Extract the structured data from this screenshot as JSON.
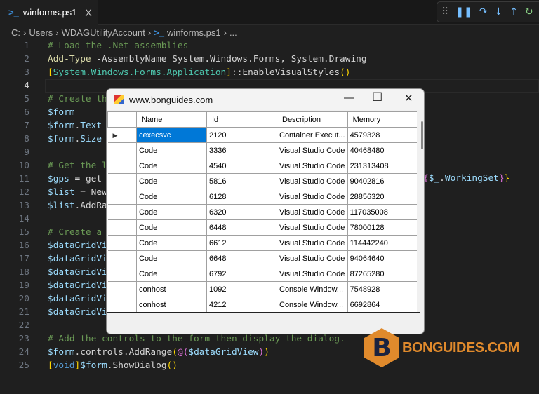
{
  "tab": {
    "title": "winforms.ps1",
    "close": "X",
    "icon": "powershell-icon"
  },
  "debug_toolbar": [
    "drag-icon",
    "pause-icon",
    "step-over-icon",
    "step-into-icon",
    "step-out-icon",
    "restart-icon"
  ],
  "breadcrumb": [
    "C:",
    "Users",
    "WDAGUtilityAccount",
    "winforms.ps1",
    "..."
  ],
  "code": [
    {
      "n": "1",
      "parts": [
        [
          "c",
          "# Load the .Net assemblies"
        ]
      ]
    },
    {
      "n": "2",
      "parts": [
        [
          "f",
          "Add-Type"
        ],
        [
          "d",
          " -AssemblyName System.Windows.Forms, System.Drawing"
        ]
      ]
    },
    {
      "n": "3",
      "parts": [
        [
          "y",
          "["
        ],
        [
          "t",
          "System.Windows.Forms.Application"
        ],
        [
          "y",
          "]"
        ],
        [
          "d",
          "::EnableVisualStyles"
        ],
        [
          "y",
          "()"
        ]
      ]
    },
    {
      "n": "4",
      "parts": []
    },
    {
      "n": "5",
      "parts": [
        [
          "c",
          "# Create th"
        ]
      ]
    },
    {
      "n": "6",
      "parts": [
        [
          "v",
          "$form"
        ]
      ]
    },
    {
      "n": "7",
      "parts": [
        [
          "v",
          "$form"
        ],
        [
          "d",
          "."
        ],
        [
          "v",
          "Text"
        ]
      ]
    },
    {
      "n": "8",
      "parts": [
        [
          "v",
          "$form"
        ],
        [
          "d",
          "."
        ],
        [
          "v",
          "Size"
        ]
      ]
    },
    {
      "n": "9",
      "parts": []
    },
    {
      "n": "10",
      "parts": [
        [
          "c",
          "# Get the l"
        ]
      ]
    },
    {
      "n": "11",
      "parts": [
        [
          "v",
          "$gps"
        ],
        [
          "d",
          " = get-"
        ]
      ]
    },
    {
      "n": "12",
      "parts": [
        [
          "v",
          "$list"
        ],
        [
          "d",
          " = New"
        ]
      ]
    },
    {
      "n": "13",
      "parts": [
        [
          "v",
          "$list"
        ],
        [
          "d",
          ".AddRa"
        ]
      ]
    },
    {
      "n": "14",
      "parts": []
    },
    {
      "n": "15",
      "parts": [
        [
          "c",
          "# Create a"
        ]
      ]
    },
    {
      "n": "16",
      "parts": [
        [
          "v",
          "$dataGridVi"
        ]
      ]
    },
    {
      "n": "17",
      "parts": [
        [
          "v",
          "$dataGridVi"
        ]
      ]
    },
    {
      "n": "18",
      "parts": [
        [
          "v",
          "$dataGridVi"
        ]
      ]
    },
    {
      "n": "19",
      "parts": [
        [
          "v",
          "$dataGridVi"
        ]
      ]
    },
    {
      "n": "20",
      "parts": [
        [
          "v",
          "$dataGridVi"
        ]
      ]
    },
    {
      "n": "21",
      "parts": [
        [
          "v",
          "$dataGridVi"
        ]
      ]
    },
    {
      "n": "22",
      "parts": []
    },
    {
      "n": "23",
      "parts": [
        [
          "c",
          "# Add the controls to the form then display the dialog."
        ]
      ]
    },
    {
      "n": "24",
      "parts": [
        [
          "v",
          "$form"
        ],
        [
          "d",
          ".controls.AddRange"
        ],
        [
          "y",
          "("
        ],
        [
          "p",
          "@("
        ],
        [
          "v",
          "$dataGridView"
        ],
        [
          "p",
          ")"
        ],
        [
          "y",
          ")"
        ]
      ]
    },
    {
      "n": "25",
      "parts": [
        [
          "y",
          "["
        ],
        [
          "k",
          "void"
        ],
        [
          "y",
          "]"
        ],
        [
          "v",
          "$form"
        ],
        [
          "d",
          ".ShowDialog"
        ],
        [
          "y",
          "()"
        ]
      ]
    }
  ],
  "line11_tail": [
    [
      "p",
      "{"
    ],
    [
      "v",
      "$_"
    ],
    [
      "d",
      "."
    ],
    [
      "v",
      "WorkingSet"
    ],
    [
      "p",
      "}"
    ],
    [
      "y",
      "}"
    ]
  ],
  "dialog": {
    "title": "www.bonguides.com",
    "columns": [
      "Name",
      "Id",
      "Description",
      "Memory"
    ],
    "rows": [
      [
        "cexecsvc",
        "2120",
        "Container Execut...",
        "4579328"
      ],
      [
        "Code",
        "3336",
        "Visual Studio Code",
        "40468480"
      ],
      [
        "Code",
        "4540",
        "Visual Studio Code",
        "231313408"
      ],
      [
        "Code",
        "5816",
        "Visual Studio Code",
        "90402816"
      ],
      [
        "Code",
        "6128",
        "Visual Studio Code",
        "28856320"
      ],
      [
        "Code",
        "6320",
        "Visual Studio Code",
        "117035008"
      ],
      [
        "Code",
        "6448",
        "Visual Studio Code",
        "78000128"
      ],
      [
        "Code",
        "6612",
        "Visual Studio Code",
        "114442240"
      ],
      [
        "Code",
        "6648",
        "Visual Studio Code",
        "94064640"
      ],
      [
        "Code",
        "6792",
        "Visual Studio Code",
        "87265280"
      ],
      [
        "conhost",
        "1092",
        "Console Window...",
        "7548928"
      ],
      [
        "conhost",
        "4212",
        "Console Window...",
        "6692864"
      ]
    ],
    "selected_row": 0
  },
  "watermark": {
    "letter": "B",
    "text": "BONGUIDES.COM",
    "color": "#e08a2c"
  }
}
